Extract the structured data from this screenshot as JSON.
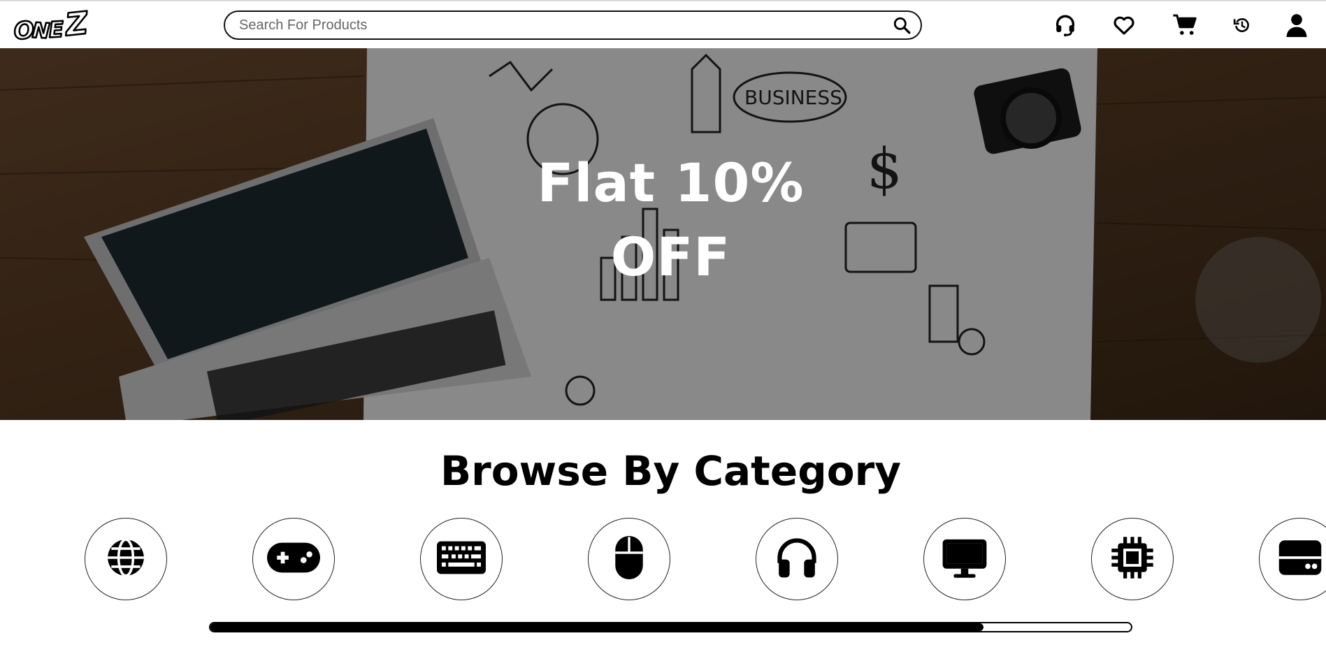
{
  "header": {
    "logo_text": "ONEZ",
    "search": {
      "placeholder": "Search For Products",
      "value": ""
    },
    "icons": [
      "support-headset-icon",
      "heart-icon",
      "cart-icon",
      "history-icon",
      "user-icon"
    ]
  },
  "hero": {
    "line1": "Flat 10%",
    "line2": "OFF"
  },
  "categories": {
    "heading": "Browse By Category",
    "items": [
      {
        "icon": "globe-icon"
      },
      {
        "icon": "gamepad-icon"
      },
      {
        "icon": "keyboard-icon"
      },
      {
        "icon": "mouse-icon"
      },
      {
        "icon": "headphones-icon"
      },
      {
        "icon": "monitor-icon"
      },
      {
        "icon": "cpu-chip-icon"
      },
      {
        "icon": "storage-drive-icon"
      }
    ],
    "scroll_progress": 0.84
  },
  "colors": {
    "accent": "#000000",
    "background": "#ffffff"
  }
}
